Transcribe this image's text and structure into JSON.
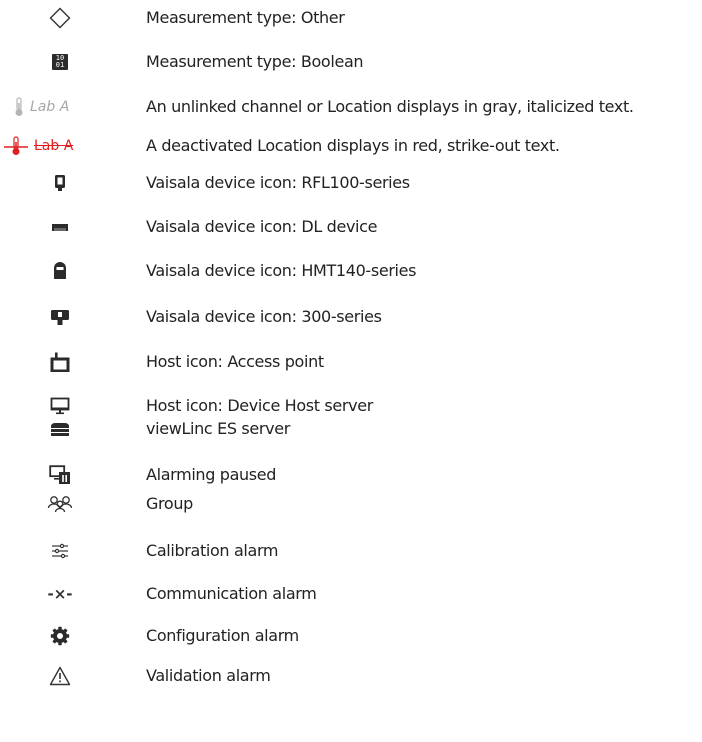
{
  "colors": {
    "icon": "#2b2b2b",
    "unlinked_gray": "#a8a8a8",
    "deactivated_red": "#e02020"
  },
  "rows": [
    {
      "icon": "diamond-outline-icon",
      "text": "Measurement type: Other"
    },
    {
      "icon": "binary-boolean-icon",
      "icon_text_top": "10",
      "icon_text_bottom": "01",
      "text": "Measurement type: Boolean"
    },
    {
      "icon": "thermometer-gray-icon",
      "sample_label": "Lab A",
      "text": "An unlinked channel or Location displays in gray, italicized text."
    },
    {
      "icon": "thermometer-red-icon",
      "sample_label": "Lab A",
      "text": "A deactivated Location displays in red, strike-out text."
    },
    {
      "icon": "rfl100-device-icon",
      "text": "Vaisala device icon: RFL100-series"
    },
    {
      "icon": "dl-device-icon",
      "text": "Vaisala device icon: DL device"
    },
    {
      "icon": "hmt140-device-icon",
      "text": "Vaisala device icon: HMT140-series"
    },
    {
      "icon": "series-300-device-icon",
      "text": "Vaisala device icon: 300-series"
    },
    {
      "icon": "access-point-icon",
      "text": "Host icon: Access point"
    },
    {
      "icon": "monitor-icon",
      "text": "Host icon: Device Host server"
    },
    {
      "icon": "server-stack-icon",
      "text": "viewLinc ES server"
    },
    {
      "icon": "alarming-paused-icon",
      "text": "Alarming paused"
    },
    {
      "icon": "group-icon",
      "text": "Group"
    },
    {
      "icon": "sliders-icon",
      "text": "Calibration alarm"
    },
    {
      "icon": "communication-alarm-icon",
      "icon_text": "-×-",
      "text": "Communication alarm"
    },
    {
      "icon": "gear-icon",
      "text": "Configuration alarm"
    },
    {
      "icon": "warning-triangle-icon",
      "text": "Validation alarm"
    }
  ]
}
